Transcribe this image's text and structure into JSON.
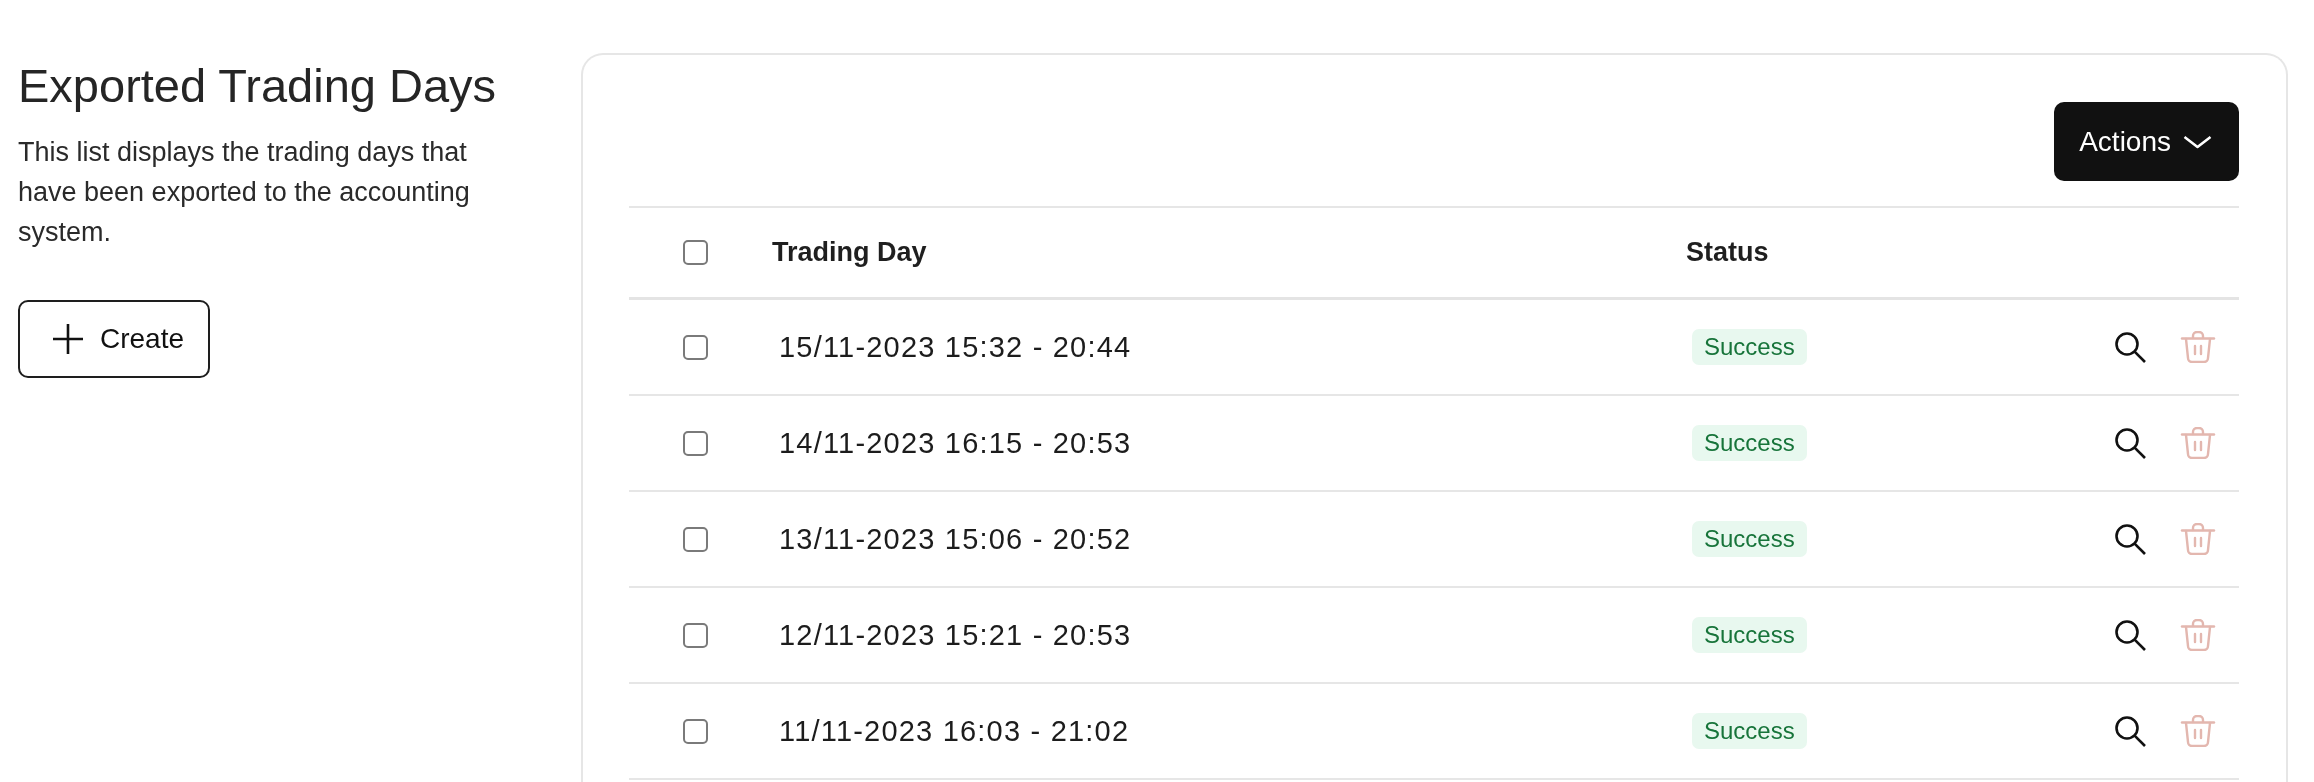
{
  "page": {
    "title": "Exported Trading Days",
    "description": "This list displays the trading days that have been exported to the accounting system.",
    "create_button": "Create"
  },
  "table": {
    "actions_button": "Actions",
    "select_all": {
      "checked": false
    },
    "columns": [
      "Trading Day",
      "Status"
    ],
    "rows": [
      {
        "checked": false,
        "trading_day": "15/11-2023 15:32 - 20:44",
        "status": {
          "label": "Success",
          "kind": "success"
        },
        "delete_disabled": true
      },
      {
        "checked": false,
        "trading_day": "14/11-2023 16:15 - 20:53",
        "status": {
          "label": "Success",
          "kind": "success"
        },
        "delete_disabled": true
      },
      {
        "checked": false,
        "trading_day": "13/11-2023 15:06 - 20:52",
        "status": {
          "label": "Success",
          "kind": "success"
        },
        "delete_disabled": true
      },
      {
        "checked": false,
        "trading_day": "12/11-2023 15:21 - 20:53",
        "status": {
          "label": "Success",
          "kind": "success"
        },
        "delete_disabled": true
      },
      {
        "checked": false,
        "trading_day": "11/11-2023 16:03 - 21:02",
        "status": {
          "label": "Success",
          "kind": "success"
        },
        "delete_disabled": true
      }
    ]
  }
}
